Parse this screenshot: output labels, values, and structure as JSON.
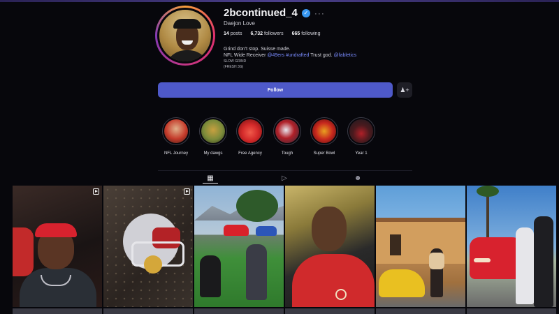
{
  "profile": {
    "username": "2bcontinued_4",
    "full_name": "Daejon Love",
    "stats": {
      "posts_count": "14",
      "posts_label": "posts",
      "followers_count": "6,732",
      "followers_label": "followers",
      "following_count": "665",
      "following_label": "following"
    },
    "bio": {
      "line1": "Grind don't stop. Suisse made.",
      "line2_prefix": "NFL Wide Receiver",
      "line2_link1": "@49ers",
      "line2_link2": "#undrafted",
      "line2_mid": "Trust god.",
      "line2_link3": "@fabletics",
      "line3": "SLOW GRIND",
      "line4": "(FRESH 3G)"
    }
  },
  "actions": {
    "follow_label": "Follow"
  },
  "highlights": [
    {
      "label": "NFL Journey",
      "colors": [
        "#c43a2a",
        "#e0b08a"
      ]
    },
    {
      "label": "My dawgs",
      "colors": [
        "#7a8a3a",
        "#c8a040"
      ]
    },
    {
      "label": "Free Agency",
      "colors": [
        "#d42a2a",
        "#8a1818"
      ]
    },
    {
      "label": "Tough",
      "colors": [
        "#d6d6e0",
        "#b02028"
      ]
    },
    {
      "label": "Super Bowl",
      "colors": [
        "#c8281e",
        "#e8a020"
      ]
    },
    {
      "label": "Year 1",
      "colors": [
        "#1a1a20",
        "#b02028"
      ]
    }
  ],
  "icons": {
    "verified": "verified-badge-icon",
    "more": "more-options-icon",
    "suggest": "suggested-users-icon",
    "posts_tab": "grid-icon",
    "reels_tab": "reels-icon",
    "tagged_tab": "tagged-icon",
    "reel_indicator": "reel-icon"
  },
  "colors": {
    "follow_button": "#4e59c9",
    "verified": "#3897f0",
    "link": "#7a8cff"
  }
}
